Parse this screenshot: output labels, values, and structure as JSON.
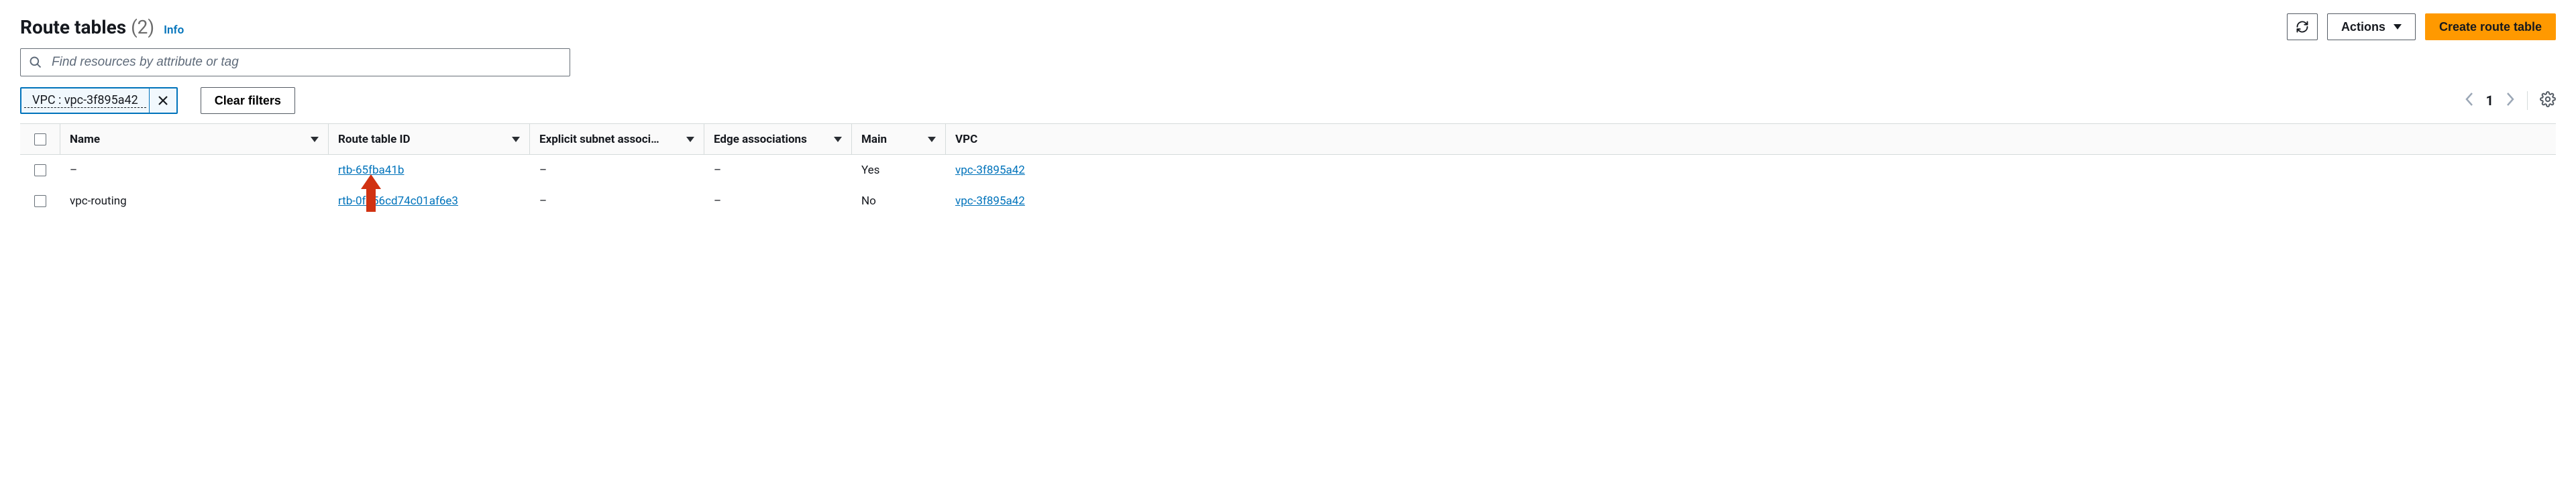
{
  "header": {
    "title": "Route tables",
    "count": "(2)",
    "info": "Info"
  },
  "toolbar": {
    "refresh_label": "Refresh",
    "actions_label": "Actions",
    "create_label": "Create route table"
  },
  "search": {
    "placeholder": "Find resources by attribute or tag"
  },
  "filters": {
    "chip_text": "VPC : vpc-3f895a42",
    "clear_label": "Clear filters"
  },
  "pagination": {
    "page": "1"
  },
  "columns": {
    "name": "Name",
    "rtb_id": "Route table ID",
    "explicit": "Explicit subnet associ…",
    "edge": "Edge associations",
    "main": "Main",
    "vpc": "VPC"
  },
  "rows": [
    {
      "name": "–",
      "rtb_id": "rtb-65fba41b",
      "explicit": "–",
      "edge": "–",
      "main": "Yes",
      "vpc": "vpc-3f895a42"
    },
    {
      "name": "vpc-routing",
      "rtb_id": "rtb-0f956cd74c01af6e3",
      "explicit": "–",
      "edge": "–",
      "main": "No",
      "vpc": "vpc-3f895a42"
    }
  ],
  "annotation": {
    "red_arrow_points_to": "rows.0.rtb_id"
  }
}
